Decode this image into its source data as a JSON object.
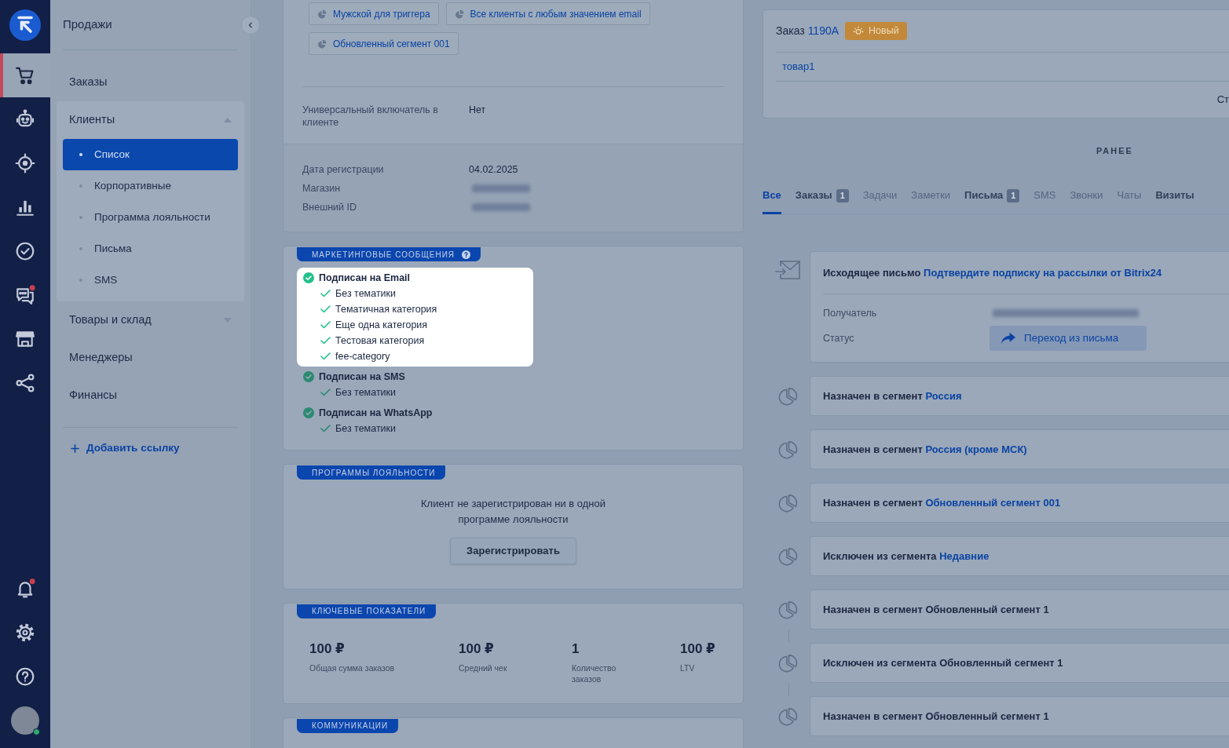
{
  "rail": {
    "items": [
      {
        "selected": true,
        "alert": false
      },
      {
        "selected": false,
        "alert": false
      },
      {
        "selected": false,
        "alert": false
      },
      {
        "selected": false,
        "alert": false
      },
      {
        "selected": false,
        "alert": false
      },
      {
        "selected": false,
        "alert": true
      },
      {
        "selected": false,
        "alert": false
      },
      {
        "selected": false,
        "alert": false
      }
    ],
    "bottom": [
      {
        "alert": true
      },
      {
        "alert": false
      },
      {
        "alert": false
      }
    ],
    "avatar": {
      "online": true
    }
  },
  "sidebar": {
    "title": "Продажи",
    "items": [
      {
        "label": "Заказы",
        "selected": false
      },
      {
        "label": "Клиенты",
        "selected": false,
        "expanded": true,
        "children": [
          {
            "label": "Список",
            "selected": true
          },
          {
            "label": "Корпоративные",
            "selected": false
          },
          {
            "label": "Программа лояльности",
            "selected": false
          },
          {
            "label": "Письма",
            "selected": false
          },
          {
            "label": "SMS",
            "selected": false
          }
        ]
      },
      {
        "label": "Товары и склад",
        "selected": false,
        "expanded": false
      },
      {
        "label": "Менеджеры",
        "selected": false
      },
      {
        "label": "Финансы",
        "selected": false
      }
    ],
    "add_link": "Добавить ссылку"
  },
  "customer": {
    "segments": [
      "Мужской для триггера",
      "Все клиенты с любым значением email",
      "Обновленный сегмент 001"
    ],
    "custom_fields": [
      {
        "label": "Универсальный включатель в клиенте",
        "kind": "text",
        "value": "Нет"
      }
    ],
    "details": [
      {
        "label": "Дата регистрации",
        "kind": "text",
        "value": "04.02.2025"
      },
      {
        "label": "Магазин",
        "kind": "blurred"
      },
      {
        "label": "Внешний ID",
        "kind": "blurred"
      }
    ]
  },
  "marketing": {
    "title": "МАРКЕТИНГОВЫЕ СООБЩЕНИЯ",
    "channels": [
      {
        "label": "Подписан на Email",
        "subscribed": true,
        "highlighted": true,
        "topics": [
          "Без тематики",
          "Тематичная категория",
          "Еще одна категория",
          "Тестовая категория",
          "fee-category"
        ]
      },
      {
        "label": "Подписан на SMS",
        "subscribed": true,
        "highlighted": false,
        "topics": [
          "Без тематики"
        ]
      },
      {
        "label": "Подписан на WhatsApp",
        "subscribed": true,
        "highlighted": false,
        "topics": [
          "Без тематики"
        ]
      }
    ]
  },
  "loyalty": {
    "title": "ПРОГРАММЫ ЛОЯЛЬНОСТИ",
    "message": "Клиент не зарегистрирован ни в одной программе лояльности",
    "button": "Зарегистрировать"
  },
  "kpis": {
    "title": "КЛЮЧЕВЫЕ ПОКАЗАТЕЛИ",
    "items": [
      {
        "value": "100 ₽",
        "label": "Общая сумма заказов"
      },
      {
        "value": "100 ₽",
        "label": "Средний чек"
      },
      {
        "value": "1",
        "label": "Количество заказов"
      },
      {
        "value": "100 ₽",
        "label": "LTV"
      }
    ]
  },
  "communications": {
    "title": "КОММУНИКАЦИИ"
  },
  "order": {
    "label": "Заказ",
    "number": "1190A",
    "status": "Новый",
    "item": "товар1",
    "footer_text": "Ст"
  },
  "timeline": {
    "heading": "РАНЕЕ",
    "tabs": [
      {
        "label": "Все",
        "selected": true,
        "disabled": false
      },
      {
        "label": "Заказы",
        "count": "1",
        "selected": false,
        "disabled": false
      },
      {
        "label": "Задачи",
        "selected": false,
        "disabled": true
      },
      {
        "label": "Заметки",
        "selected": false,
        "disabled": true
      },
      {
        "label": "Письма",
        "count": "1",
        "selected": false,
        "disabled": false
      },
      {
        "label": "SMS",
        "selected": false,
        "disabled": true
      },
      {
        "label": "Звонки",
        "selected": false,
        "disabled": true
      },
      {
        "label": "Чаты",
        "selected": false,
        "disabled": true
      },
      {
        "label": "Визиты",
        "selected": false,
        "disabled": false
      }
    ],
    "events": [
      {
        "kind": "email",
        "title": "Исходящее письмо",
        "subject": "Подтвердите подписку на рассылки от Bitrix24",
        "connected": false,
        "fields": [
          {
            "label": "Получатель",
            "kind": "blurred"
          },
          {
            "label": "Статус",
            "kind": "status",
            "value": "Переход из письма"
          }
        ]
      },
      {
        "kind": "segment",
        "action": "Назначен в сегмент",
        "segment": "Россия",
        "segment_link": true,
        "connected": false
      },
      {
        "kind": "segment",
        "action": "Назначен в сегмент",
        "segment": "Россия (кроме МСК)",
        "segment_link": true,
        "connected": false
      },
      {
        "kind": "segment",
        "action": "Назначен в сегмент",
        "segment": "Обновленный сегмент 001",
        "segment_link": true,
        "connected": false
      },
      {
        "kind": "segment",
        "action": "Исключен из сегмента",
        "segment": "Недавние",
        "segment_link": true,
        "connected": false
      },
      {
        "kind": "segment",
        "action": "Назначен в сегмент",
        "segment": "Обновленный сегмент 1",
        "segment_link": false,
        "connected": false
      },
      {
        "kind": "segment",
        "action": "Исключен из сегмента",
        "segment": "Обновленный сегмент 1",
        "segment_link": false,
        "connected": true
      },
      {
        "kind": "segment",
        "action": "Назначен в сегмент",
        "segment": "Обновленный сегмент 1",
        "segment_link": false,
        "connected": true
      }
    ]
  }
}
